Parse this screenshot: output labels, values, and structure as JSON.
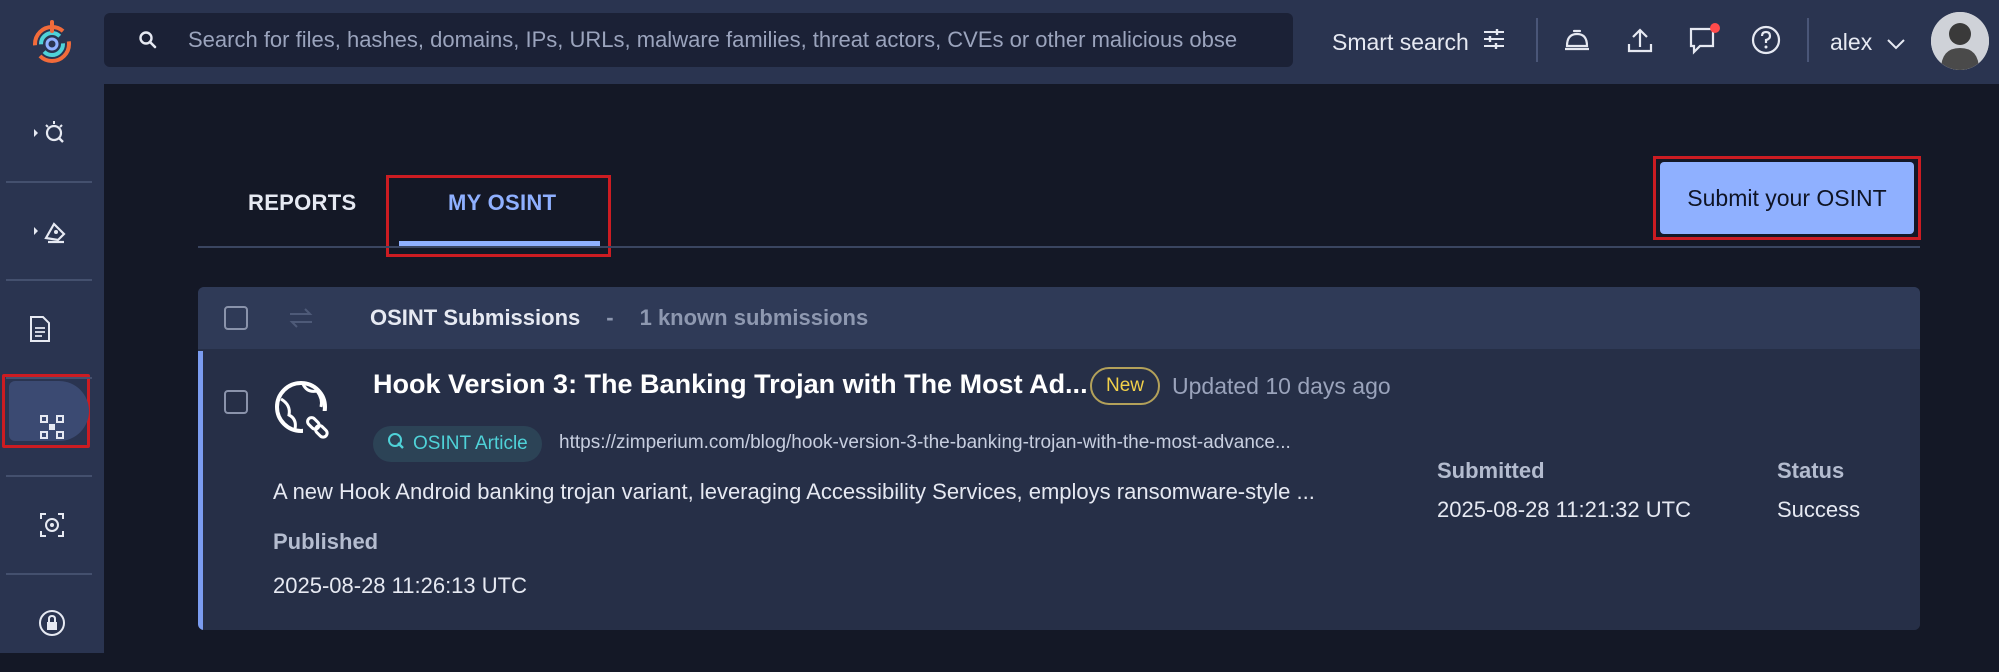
{
  "search": {
    "placeholder": "Search for files, hashes, domains, IPs, URLs, malware families, threat actors, CVEs or other malicious obse"
  },
  "topbar": {
    "smart_search_label": "Smart search",
    "user_name": "alex",
    "icons": [
      "bell-icon",
      "upload-icon",
      "chat-icon",
      "help-icon"
    ]
  },
  "tabs": [
    {
      "label": "REPORTS",
      "active": false
    },
    {
      "label": "MY OSINT",
      "active": true
    }
  ],
  "submit_button": "Submit your OSINT",
  "list": {
    "header_title": "OSINT Submissions",
    "separator": "-",
    "count_text": "1 known submissions",
    "items": [
      {
        "title": "Hook Version 3: The Banking Trojan with The Most Ad...",
        "badge": "New",
        "updated": "Updated 10 days ago",
        "tag": "OSINT Article",
        "url": "https://zimperium.com/blog/hook-version-3-the-banking-trojan-with-the-most-advance...",
        "description": "A new Hook Android banking trojan variant, leveraging Accessibility Services, employs ransomware-style ...",
        "published_label": "Published",
        "published_value": "2025-08-28 11:26:13 UTC",
        "submitted_label": "Submitted",
        "submitted_value": "2025-08-28 11:21:32 UTC",
        "status_label": "Status",
        "status_value": "Success"
      }
    ]
  },
  "colors": {
    "accent": "#8fb0ff",
    "highlight_box": "#cc1c22",
    "badge_new": "#f2d14a",
    "tag_text": "#4fd2d8"
  }
}
